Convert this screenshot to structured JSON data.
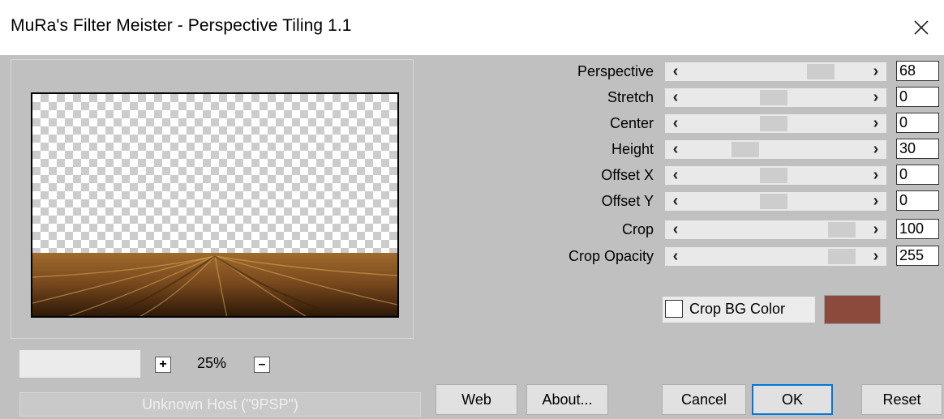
{
  "window": {
    "title": "MuRa's Filter Meister - Perspective Tiling 1.1",
    "close_glyph": "✕"
  },
  "sliders": [
    {
      "label": "Perspective",
      "value": "68",
      "level": 0.68
    },
    {
      "label": "Stretch",
      "value": "0",
      "level": 0.5
    },
    {
      "label": "Center",
      "value": "0",
      "level": 0.5
    },
    {
      "label": "Height",
      "value": "30",
      "level": 0.33
    },
    {
      "label": "Offset X",
      "value": "0",
      "level": 0.5
    },
    {
      "label": "Offset Y",
      "value": "0",
      "level": 0.5
    },
    {
      "label": "Crop",
      "value": "100",
      "level": 0.92
    },
    {
      "label": "Crop Opacity",
      "value": "255",
      "level": 0.92
    }
  ],
  "slider_arrows": {
    "left": "‹",
    "right": "›"
  },
  "crop_bg": {
    "label": "Crop BG Color",
    "checked": false,
    "color": "#8b4a3b"
  },
  "zoom": {
    "plus": "+",
    "minus": "–",
    "value": "25%"
  },
  "host": {
    "text": "Unknown Host (\"9PSP\")"
  },
  "buttons": {
    "web": "Web",
    "about": "About...",
    "cancel": "Cancel",
    "ok": "OK",
    "reset": "Reset"
  },
  "colors": {
    "dialog_bg": "#c0c0c0",
    "accent": "#0078d7",
    "floor": "#7a4a1e"
  }
}
